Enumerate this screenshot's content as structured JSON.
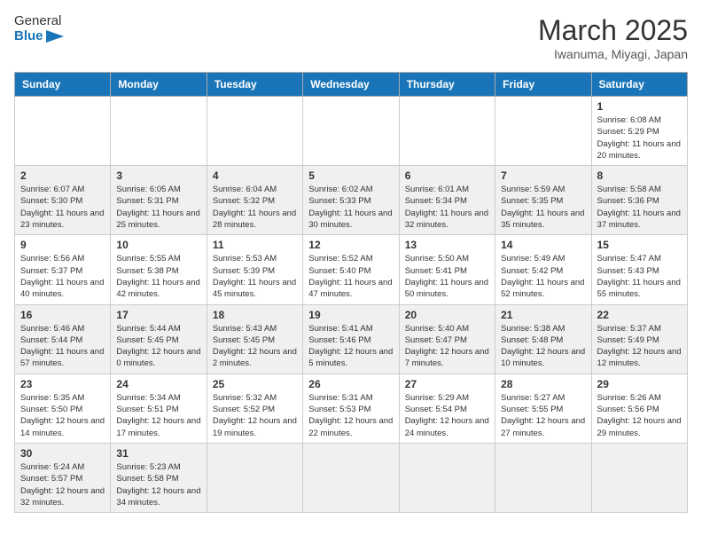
{
  "header": {
    "logo_general": "General",
    "logo_blue": "Blue",
    "month": "March 2025",
    "location": "Iwanuma, Miyagi, Japan"
  },
  "weekdays": [
    "Sunday",
    "Monday",
    "Tuesday",
    "Wednesday",
    "Thursday",
    "Friday",
    "Saturday"
  ],
  "weeks": [
    [
      {
        "day": "",
        "info": ""
      },
      {
        "day": "",
        "info": ""
      },
      {
        "day": "",
        "info": ""
      },
      {
        "day": "",
        "info": ""
      },
      {
        "day": "",
        "info": ""
      },
      {
        "day": "",
        "info": ""
      },
      {
        "day": "1",
        "info": "Sunrise: 6:08 AM\nSunset: 5:29 PM\nDaylight: 11 hours\nand 20 minutes."
      }
    ],
    [
      {
        "day": "2",
        "info": "Sunrise: 6:07 AM\nSunset: 5:30 PM\nDaylight: 11 hours\nand 23 minutes."
      },
      {
        "day": "3",
        "info": "Sunrise: 6:05 AM\nSunset: 5:31 PM\nDaylight: 11 hours\nand 25 minutes."
      },
      {
        "day": "4",
        "info": "Sunrise: 6:04 AM\nSunset: 5:32 PM\nDaylight: 11 hours\nand 28 minutes."
      },
      {
        "day": "5",
        "info": "Sunrise: 6:02 AM\nSunset: 5:33 PM\nDaylight: 11 hours\nand 30 minutes."
      },
      {
        "day": "6",
        "info": "Sunrise: 6:01 AM\nSunset: 5:34 PM\nDaylight: 11 hours\nand 32 minutes."
      },
      {
        "day": "7",
        "info": "Sunrise: 5:59 AM\nSunset: 5:35 PM\nDaylight: 11 hours\nand 35 minutes."
      },
      {
        "day": "8",
        "info": "Sunrise: 5:58 AM\nSunset: 5:36 PM\nDaylight: 11 hours\nand 37 minutes."
      }
    ],
    [
      {
        "day": "9",
        "info": "Sunrise: 5:56 AM\nSunset: 5:37 PM\nDaylight: 11 hours\nand 40 minutes."
      },
      {
        "day": "10",
        "info": "Sunrise: 5:55 AM\nSunset: 5:38 PM\nDaylight: 11 hours\nand 42 minutes."
      },
      {
        "day": "11",
        "info": "Sunrise: 5:53 AM\nSunset: 5:39 PM\nDaylight: 11 hours\nand 45 minutes."
      },
      {
        "day": "12",
        "info": "Sunrise: 5:52 AM\nSunset: 5:40 PM\nDaylight: 11 hours\nand 47 minutes."
      },
      {
        "day": "13",
        "info": "Sunrise: 5:50 AM\nSunset: 5:41 PM\nDaylight: 11 hours\nand 50 minutes."
      },
      {
        "day": "14",
        "info": "Sunrise: 5:49 AM\nSunset: 5:42 PM\nDaylight: 11 hours\nand 52 minutes."
      },
      {
        "day": "15",
        "info": "Sunrise: 5:47 AM\nSunset: 5:43 PM\nDaylight: 11 hours\nand 55 minutes."
      }
    ],
    [
      {
        "day": "16",
        "info": "Sunrise: 5:46 AM\nSunset: 5:44 PM\nDaylight: 11 hours\nand 57 minutes."
      },
      {
        "day": "17",
        "info": "Sunrise: 5:44 AM\nSunset: 5:45 PM\nDaylight: 12 hours\nand 0 minutes."
      },
      {
        "day": "18",
        "info": "Sunrise: 5:43 AM\nSunset: 5:45 PM\nDaylight: 12 hours\nand 2 minutes."
      },
      {
        "day": "19",
        "info": "Sunrise: 5:41 AM\nSunset: 5:46 PM\nDaylight: 12 hours\nand 5 minutes."
      },
      {
        "day": "20",
        "info": "Sunrise: 5:40 AM\nSunset: 5:47 PM\nDaylight: 12 hours\nand 7 minutes."
      },
      {
        "day": "21",
        "info": "Sunrise: 5:38 AM\nSunset: 5:48 PM\nDaylight: 12 hours\nand 10 minutes."
      },
      {
        "day": "22",
        "info": "Sunrise: 5:37 AM\nSunset: 5:49 PM\nDaylight: 12 hours\nand 12 minutes."
      }
    ],
    [
      {
        "day": "23",
        "info": "Sunrise: 5:35 AM\nSunset: 5:50 PM\nDaylight: 12 hours\nand 14 minutes."
      },
      {
        "day": "24",
        "info": "Sunrise: 5:34 AM\nSunset: 5:51 PM\nDaylight: 12 hours\nand 17 minutes."
      },
      {
        "day": "25",
        "info": "Sunrise: 5:32 AM\nSunset: 5:52 PM\nDaylight: 12 hours\nand 19 minutes."
      },
      {
        "day": "26",
        "info": "Sunrise: 5:31 AM\nSunset: 5:53 PM\nDaylight: 12 hours\nand 22 minutes."
      },
      {
        "day": "27",
        "info": "Sunrise: 5:29 AM\nSunset: 5:54 PM\nDaylight: 12 hours\nand 24 minutes."
      },
      {
        "day": "28",
        "info": "Sunrise: 5:27 AM\nSunset: 5:55 PM\nDaylight: 12 hours\nand 27 minutes."
      },
      {
        "day": "29",
        "info": "Sunrise: 5:26 AM\nSunset: 5:56 PM\nDaylight: 12 hours\nand 29 minutes."
      }
    ],
    [
      {
        "day": "30",
        "info": "Sunrise: 5:24 AM\nSunset: 5:57 PM\nDaylight: 12 hours\nand 32 minutes."
      },
      {
        "day": "31",
        "info": "Sunrise: 5:23 AM\nSunset: 5:58 PM\nDaylight: 12 hours\nand 34 minutes."
      },
      {
        "day": "",
        "info": ""
      },
      {
        "day": "",
        "info": ""
      },
      {
        "day": "",
        "info": ""
      },
      {
        "day": "",
        "info": ""
      },
      {
        "day": "",
        "info": ""
      }
    ]
  ]
}
